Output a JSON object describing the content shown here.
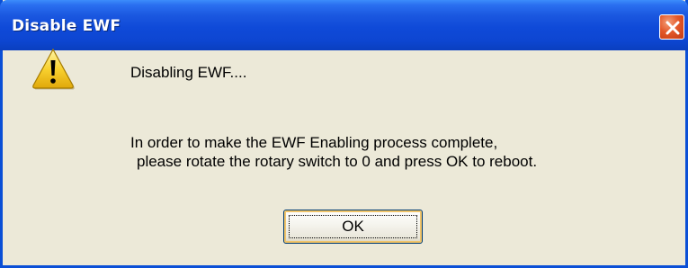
{
  "dialog": {
    "title": "Disable EWF",
    "message_heading": "Disabling EWF....",
    "message_line1": "In order to make the EWF Enabling process complete,",
    "message_line2": "please rotate the rotary switch to 0 and press OK to reboot.",
    "ok_label": "OK",
    "icon": "warning-icon",
    "close_icon": "close-icon"
  },
  "colors": {
    "titlebar": "#0d46d2",
    "close_button": "#e3582a",
    "dialog_background": "#ece9d8",
    "warning_yellow": "#f9d230"
  }
}
